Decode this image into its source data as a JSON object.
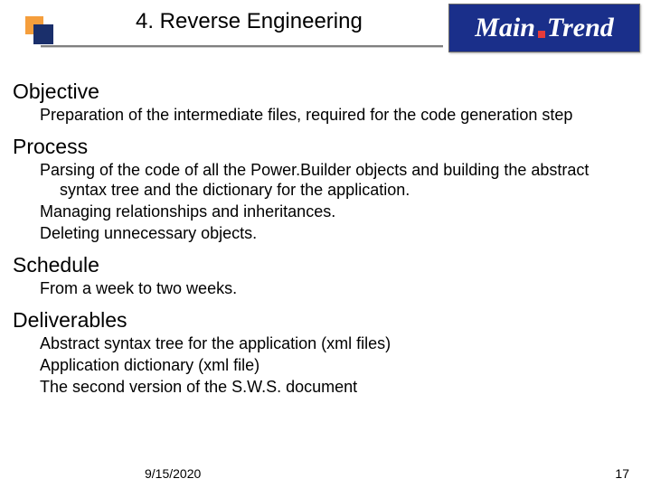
{
  "header": {
    "title": "4. Reverse Engineering",
    "logo_main": "Main",
    "logo_trend": "Trend"
  },
  "sections": {
    "objective": {
      "head": "Objective",
      "lines": [
        "Preparation of the intermediate files, required for the code generation step"
      ]
    },
    "process": {
      "head": "Process",
      "lines": [
        "Parsing of the code of all the Power.Builder objects and building the abstract syntax tree and the dictionary for the application.",
        "Managing relationships and inheritances.",
        "Deleting unnecessary objects."
      ]
    },
    "schedule": {
      "head": "Schedule",
      "lines": [
        "From a week to two weeks."
      ]
    },
    "deliverables": {
      "head": "Deliverables",
      "lines": [
        "Abstract syntax tree for the application (xml files)",
        "Application dictionary (xml file)",
        "The second version of the S.W.S. document"
      ]
    }
  },
  "footer": {
    "date": "9/15/2020",
    "page": "17"
  }
}
